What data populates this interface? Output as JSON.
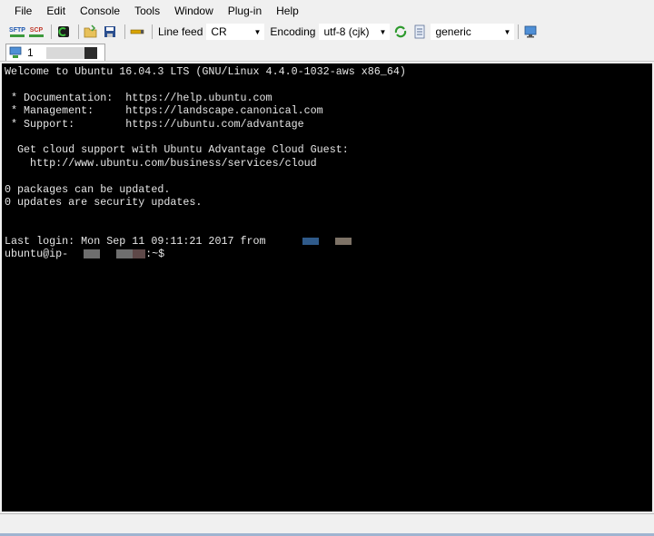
{
  "menu": [
    "File",
    "Edit",
    "Console",
    "Tools",
    "Window",
    "Plug-in",
    "Help"
  ],
  "toolbar": {
    "sftp_label": "SFTP",
    "scp_label": "SCP",
    "line_feed_label": "Line feed",
    "line_feed_value": "CR",
    "encoding_label": "Encoding",
    "encoding_value": "utf-8 (cjk)",
    "terminal_type_value": "generic"
  },
  "tab": {
    "label": "1"
  },
  "terminal": {
    "lines": [
      "Welcome to Ubuntu 16.04.3 LTS (GNU/Linux 4.4.0-1032-aws x86_64)",
      "",
      " * Documentation:  https://help.ubuntu.com",
      " * Management:     https://landscape.canonical.com",
      " * Support:        https://ubuntu.com/advantage",
      "",
      "  Get cloud support with Ubuntu Advantage Cloud Guest:",
      "    http://www.ubuntu.com/business/services/cloud",
      "",
      "0 packages can be updated.",
      "0 updates are security updates.",
      "",
      ""
    ],
    "last_login": "Last login: Mon Sep 11 09:11:21 2017 from",
    "prompt_user": "ubuntu@ip-",
    "prompt_suffix": ":~$"
  },
  "colors": {
    "terminal_bg": "#000000",
    "terminal_fg": "#e6e6e6",
    "redact_blue": "#2f5a8a",
    "redact_tan": "#7d7266",
    "redact_gray": "#6e6e6e"
  }
}
